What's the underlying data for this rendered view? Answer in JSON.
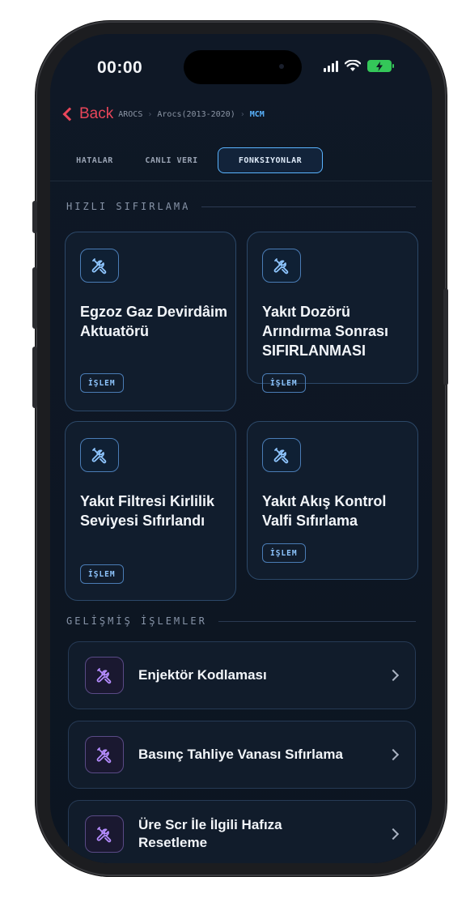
{
  "status_bar": {
    "time": "00:00",
    "battery_icon": "charging-bolt"
  },
  "nav": {
    "back_label": "Back",
    "crumbs": [
      "AROCS",
      "Arocs(2013-2020)",
      "MCM"
    ]
  },
  "tabs": [
    {
      "label": "HATALAR",
      "active": false
    },
    {
      "label": "CANLI VERI",
      "active": false
    },
    {
      "label": "FONKSIYONLAR",
      "active": true
    }
  ],
  "quick_reset": {
    "heading": "HIZLI SIFIRLAMA",
    "cards": [
      {
        "title": "Egzoz Gaz Devirdâim Aktuatörü",
        "badge": "İŞLEM",
        "icon": "tools-icon"
      },
      {
        "title": "Yakıt Dozörü Arındırma Sonrası SIFIRLANMASI",
        "badge": "İŞLEM",
        "icon": "tools-icon"
      },
      {
        "title": "Yakıt Filtresi Kirlilik Seviyesi Sıfırlandı",
        "badge": "İŞLEM",
        "icon": "tools-icon"
      },
      {
        "title": "Yakıt Akış Kontrol Valfi Sıfırlama",
        "badge": "İŞLEM",
        "icon": "tools-icon"
      }
    ]
  },
  "advanced": {
    "heading": "GELİŞMİŞ İŞLEMLER",
    "items": [
      {
        "label": "Enjektör Kodlaması",
        "icon": "tools-icon"
      },
      {
        "label": "Basınç Tahliye Vanası Sıfırlama",
        "icon": "tools-icon"
      },
      {
        "label": "Üre Scr İle İlgili Hafıza Resetleme",
        "icon": "tools-icon"
      }
    ]
  },
  "colors": {
    "accent_blue": "#5ab4ff",
    "back_red": "#e8465a",
    "advanced_icon_purple": "#b58cff",
    "screen_bg": "#0e1724"
  }
}
